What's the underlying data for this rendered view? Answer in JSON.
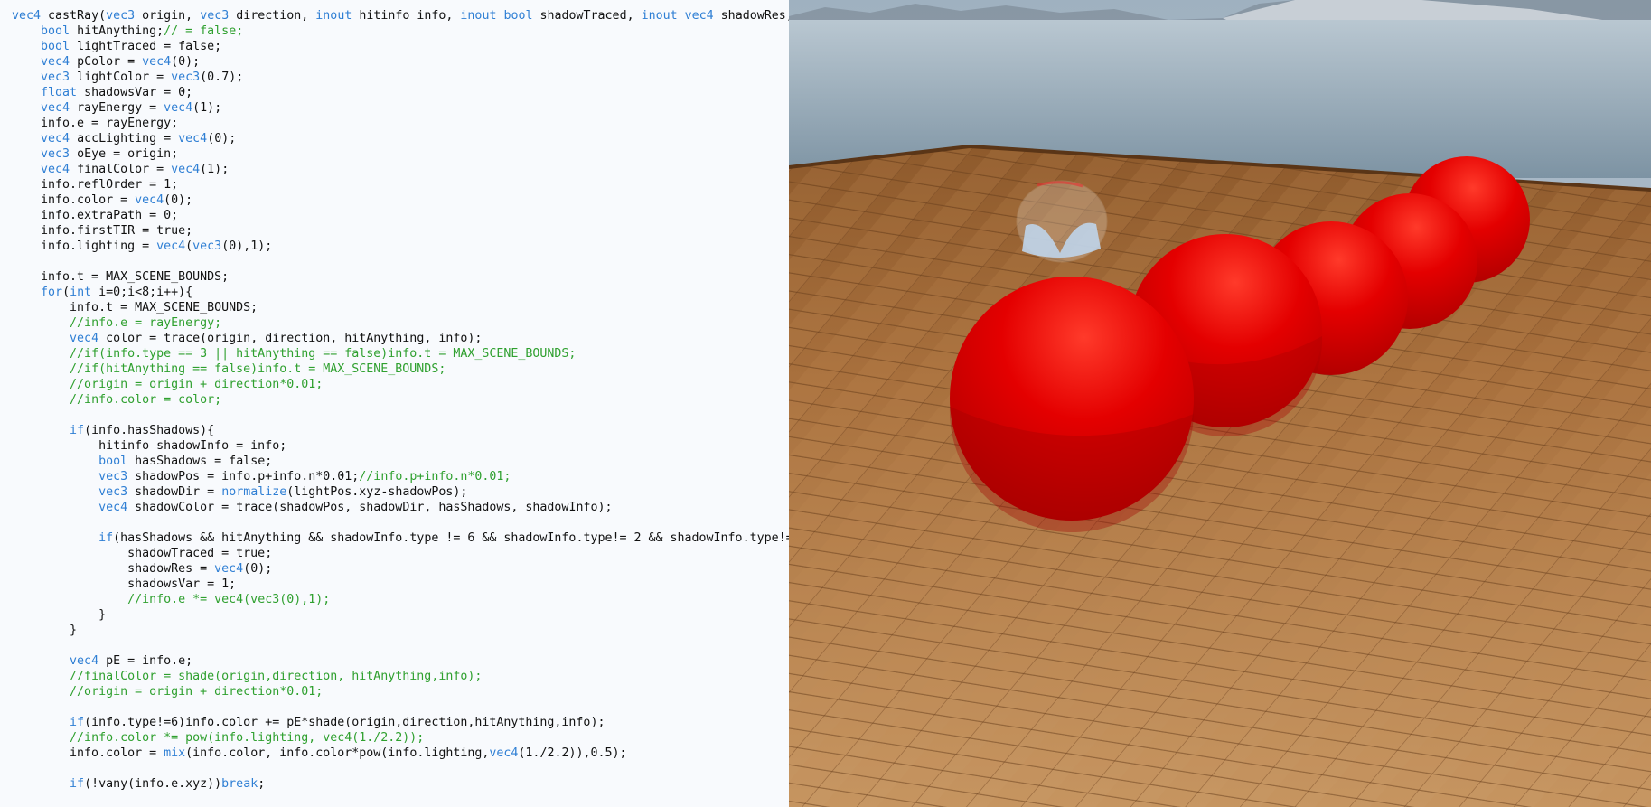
{
  "editor": {
    "language": "GLSL",
    "colors": {
      "background": "#f8fafd",
      "text": "#111111",
      "keyword": "#2f7fd4",
      "comment": "#2fa02f"
    },
    "lines": [
      {
        "tokens": [
          {
            "t": "kw",
            "v": "vec4"
          },
          {
            "t": "pl",
            "v": " castRay("
          },
          {
            "t": "kw",
            "v": "vec3"
          },
          {
            "t": "pl",
            "v": " origin, "
          },
          {
            "t": "kw",
            "v": "vec3"
          },
          {
            "t": "pl",
            "v": " direction, "
          },
          {
            "t": "kw",
            "v": "inout"
          },
          {
            "t": "pl",
            "v": " hitinfo info, "
          },
          {
            "t": "kw",
            "v": "inout"
          },
          {
            "t": "pl",
            "v": " "
          },
          {
            "t": "kw",
            "v": "bool"
          },
          {
            "t": "pl",
            "v": " shadowTraced, "
          },
          {
            "t": "kw",
            "v": "inout"
          },
          {
            "t": "pl",
            "v": " "
          },
          {
            "t": "kw",
            "v": "vec4"
          },
          {
            "t": "pl",
            "v": " shadowRes,"
          }
        ]
      },
      {
        "tokens": [
          {
            "t": "pl",
            "v": "    "
          },
          {
            "t": "kw",
            "v": "bool"
          },
          {
            "t": "pl",
            "v": " hitAnything;"
          },
          {
            "t": "cm",
            "v": "// = false;"
          }
        ]
      },
      {
        "tokens": [
          {
            "t": "pl",
            "v": "    "
          },
          {
            "t": "kw",
            "v": "bool"
          },
          {
            "t": "pl",
            "v": " lightTraced = false;"
          }
        ]
      },
      {
        "tokens": [
          {
            "t": "pl",
            "v": "    "
          },
          {
            "t": "kw",
            "v": "vec4"
          },
          {
            "t": "pl",
            "v": " pColor = "
          },
          {
            "t": "kw",
            "v": "vec4"
          },
          {
            "t": "pl",
            "v": "(0);"
          }
        ]
      },
      {
        "tokens": [
          {
            "t": "pl",
            "v": "    "
          },
          {
            "t": "kw",
            "v": "vec3"
          },
          {
            "t": "pl",
            "v": " lightColor = "
          },
          {
            "t": "kw",
            "v": "vec3"
          },
          {
            "t": "pl",
            "v": "(0.7);"
          }
        ]
      },
      {
        "tokens": [
          {
            "t": "pl",
            "v": "    "
          },
          {
            "t": "kw",
            "v": "float"
          },
          {
            "t": "pl",
            "v": " shadowsVar = 0;"
          }
        ]
      },
      {
        "tokens": [
          {
            "t": "pl",
            "v": "    "
          },
          {
            "t": "kw",
            "v": "vec4"
          },
          {
            "t": "pl",
            "v": " rayEnergy = "
          },
          {
            "t": "kw",
            "v": "vec4"
          },
          {
            "t": "pl",
            "v": "(1);"
          }
        ]
      },
      {
        "tokens": [
          {
            "t": "pl",
            "v": "    info.e = rayEnergy;"
          }
        ]
      },
      {
        "tokens": [
          {
            "t": "pl",
            "v": "    "
          },
          {
            "t": "kw",
            "v": "vec4"
          },
          {
            "t": "pl",
            "v": " accLighting = "
          },
          {
            "t": "kw",
            "v": "vec4"
          },
          {
            "t": "pl",
            "v": "(0);"
          }
        ]
      },
      {
        "tokens": [
          {
            "t": "pl",
            "v": "    "
          },
          {
            "t": "kw",
            "v": "vec3"
          },
          {
            "t": "pl",
            "v": " oEye = origin;"
          }
        ]
      },
      {
        "tokens": [
          {
            "t": "pl",
            "v": "    "
          },
          {
            "t": "kw",
            "v": "vec4"
          },
          {
            "t": "pl",
            "v": " finalColor = "
          },
          {
            "t": "kw",
            "v": "vec4"
          },
          {
            "t": "pl",
            "v": "(1);"
          }
        ]
      },
      {
        "tokens": [
          {
            "t": "pl",
            "v": "    info.reflOrder = 1;"
          }
        ]
      },
      {
        "tokens": [
          {
            "t": "pl",
            "v": "    info.color = "
          },
          {
            "t": "kw",
            "v": "vec4"
          },
          {
            "t": "pl",
            "v": "(0);"
          }
        ]
      },
      {
        "tokens": [
          {
            "t": "pl",
            "v": "    info.extraPath = 0;"
          }
        ]
      },
      {
        "tokens": [
          {
            "t": "pl",
            "v": "    info.firstTIR = true;"
          }
        ]
      },
      {
        "tokens": [
          {
            "t": "pl",
            "v": "    info.lighting = "
          },
          {
            "t": "kw",
            "v": "vec4"
          },
          {
            "t": "pl",
            "v": "("
          },
          {
            "t": "kw",
            "v": "vec3"
          },
          {
            "t": "pl",
            "v": "(0),1);"
          }
        ]
      },
      {
        "tokens": []
      },
      {
        "tokens": [
          {
            "t": "pl",
            "v": "    info.t = MAX_SCENE_BOUNDS;"
          }
        ]
      },
      {
        "tokens": [
          {
            "t": "pl",
            "v": "    "
          },
          {
            "t": "kw",
            "v": "for"
          },
          {
            "t": "pl",
            "v": "("
          },
          {
            "t": "kw",
            "v": "int"
          },
          {
            "t": "pl",
            "v": " i=0;i<8;i++){"
          }
        ]
      },
      {
        "tokens": [
          {
            "t": "pl",
            "v": "        info.t = MAX_SCENE_BOUNDS;"
          }
        ]
      },
      {
        "tokens": [
          {
            "t": "pl",
            "v": "        "
          },
          {
            "t": "cm",
            "v": "//info.e = rayEnergy;"
          }
        ]
      },
      {
        "tokens": [
          {
            "t": "pl",
            "v": "        "
          },
          {
            "t": "kw",
            "v": "vec4"
          },
          {
            "t": "pl",
            "v": " color = trace(origin, direction, hitAnything, info);"
          }
        ]
      },
      {
        "tokens": [
          {
            "t": "pl",
            "v": "        "
          },
          {
            "t": "cm",
            "v": "//if(info.type == 3 || hitAnything == false)info.t = MAX_SCENE_BOUNDS;"
          }
        ]
      },
      {
        "tokens": [
          {
            "t": "pl",
            "v": "        "
          },
          {
            "t": "cm",
            "v": "//if(hitAnything == false)info.t = MAX_SCENE_BOUNDS;"
          }
        ]
      },
      {
        "tokens": [
          {
            "t": "pl",
            "v": "        "
          },
          {
            "t": "cm",
            "v": "//origin = origin + direction*0.01;"
          }
        ]
      },
      {
        "tokens": [
          {
            "t": "pl",
            "v": "        "
          },
          {
            "t": "cm",
            "v": "//info.color = color;"
          }
        ]
      },
      {
        "tokens": []
      },
      {
        "tokens": [
          {
            "t": "pl",
            "v": "        "
          },
          {
            "t": "kw",
            "v": "if"
          },
          {
            "t": "pl",
            "v": "(info.hasShadows){"
          }
        ]
      },
      {
        "tokens": [
          {
            "t": "pl",
            "v": "            hitinfo shadowInfo = info;"
          }
        ]
      },
      {
        "tokens": [
          {
            "t": "pl",
            "v": "            "
          },
          {
            "t": "kw",
            "v": "bool"
          },
          {
            "t": "pl",
            "v": " hasShadows = false;"
          }
        ]
      },
      {
        "tokens": [
          {
            "t": "pl",
            "v": "            "
          },
          {
            "t": "kw",
            "v": "vec3"
          },
          {
            "t": "pl",
            "v": " shadowPos = info.p+info.n*0.01;"
          },
          {
            "t": "cm",
            "v": "//info.p+info.n*0.01;"
          }
        ]
      },
      {
        "tokens": [
          {
            "t": "pl",
            "v": "            "
          },
          {
            "t": "kw",
            "v": "vec3"
          },
          {
            "t": "pl",
            "v": " shadowDir = "
          },
          {
            "t": "kw",
            "v": "normalize"
          },
          {
            "t": "pl",
            "v": "(lightPos.xyz-shadowPos);"
          }
        ]
      },
      {
        "tokens": [
          {
            "t": "pl",
            "v": "            "
          },
          {
            "t": "kw",
            "v": "vec4"
          },
          {
            "t": "pl",
            "v": " shadowColor = trace(shadowPos, shadowDir, hasShadows, shadowInfo);"
          }
        ]
      },
      {
        "tokens": []
      },
      {
        "tokens": [
          {
            "t": "pl",
            "v": "            "
          },
          {
            "t": "kw",
            "v": "if"
          },
          {
            "t": "pl",
            "v": "(hasShadows && hitAnything && shadowInfo.type != 6 && shadowInfo.type!= 2 && shadowInfo.type!="
          }
        ]
      },
      {
        "tokens": [
          {
            "t": "pl",
            "v": "                shadowTraced = true;"
          }
        ]
      },
      {
        "tokens": [
          {
            "t": "pl",
            "v": "                shadowRes = "
          },
          {
            "t": "kw",
            "v": "vec4"
          },
          {
            "t": "pl",
            "v": "(0);"
          }
        ]
      },
      {
        "tokens": [
          {
            "t": "pl",
            "v": "                shadowsVar = 1;"
          }
        ]
      },
      {
        "tokens": [
          {
            "t": "pl",
            "v": "                "
          },
          {
            "t": "cm",
            "v": "//info.e *= vec4(vec3(0),1);"
          }
        ]
      },
      {
        "tokens": [
          {
            "t": "pl",
            "v": "            }"
          }
        ]
      },
      {
        "tokens": [
          {
            "t": "pl",
            "v": "        }"
          }
        ]
      },
      {
        "tokens": []
      },
      {
        "tokens": [
          {
            "t": "pl",
            "v": "        "
          },
          {
            "t": "kw",
            "v": "vec4"
          },
          {
            "t": "pl",
            "v": " pE = info.e;"
          }
        ]
      },
      {
        "tokens": [
          {
            "t": "pl",
            "v": "        "
          },
          {
            "t": "cm",
            "v": "//finalColor = shade(origin,direction, hitAnything,info);"
          }
        ]
      },
      {
        "tokens": [
          {
            "t": "pl",
            "v": "        "
          },
          {
            "t": "cm",
            "v": "//origin = origin + direction*0.01;"
          }
        ]
      },
      {
        "tokens": []
      },
      {
        "tokens": [
          {
            "t": "pl",
            "v": "        "
          },
          {
            "t": "kw",
            "v": "if"
          },
          {
            "t": "pl",
            "v": "(info.type!=6)info.color += pE*shade(origin,direction,hitAnything,info);"
          }
        ]
      },
      {
        "tokens": [
          {
            "t": "pl",
            "v": "        "
          },
          {
            "t": "cm",
            "v": "//info.color *= pow(info.lighting, vec4(1./2.2));"
          }
        ]
      },
      {
        "tokens": [
          {
            "t": "pl",
            "v": "        info.color = "
          },
          {
            "t": "kw",
            "v": "mix"
          },
          {
            "t": "pl",
            "v": "(info.color, info.color*pow(info.lighting,"
          },
          {
            "t": "kw",
            "v": "vec4"
          },
          {
            "t": "pl",
            "v": "(1./2.2)),0.5);"
          }
        ]
      },
      {
        "tokens": []
      },
      {
        "tokens": [
          {
            "t": "pl",
            "v": "        "
          },
          {
            "t": "kw",
            "v": "if"
          },
          {
            "t": "pl",
            "v": "(!vany(info.e.xyz))"
          },
          {
            "t": "kw",
            "v": "break"
          },
          {
            "t": "pl",
            "v": ";"
          }
        ]
      }
    ]
  },
  "viewport": {
    "colors": {
      "sky": "#c9d3dc",
      "water": "#8fa4b3",
      "floor": "#b07a45",
      "floor_dark": "#7a4e26",
      "sphere": "#e30000",
      "sphere_highlight": "#ff4a3a",
      "sphere_shadow": "#9c0000"
    },
    "objects": [
      {
        "name": "sphere-icon-1"
      },
      {
        "name": "sphere-icon-2"
      },
      {
        "name": "sphere-icon-3"
      },
      {
        "name": "sphere-icon-4"
      },
      {
        "name": "sphere-icon-5"
      },
      {
        "name": "glass-object-icon"
      }
    ]
  }
}
